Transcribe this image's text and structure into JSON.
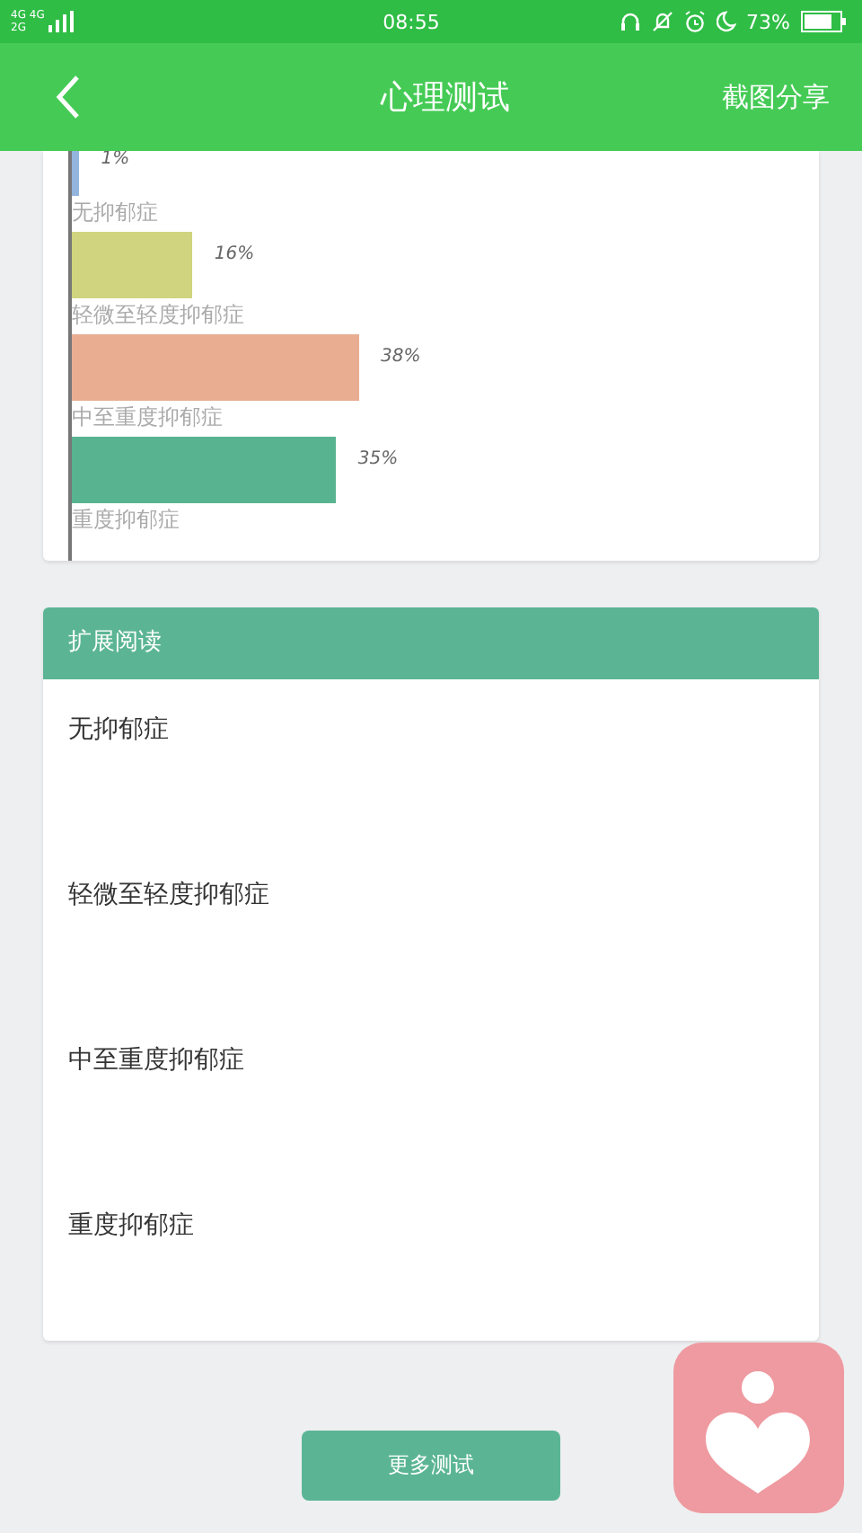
{
  "status_bar": {
    "network_top": "4G 4G",
    "network_bottom": "2G",
    "time": "08:55",
    "battery": "73%"
  },
  "header": {
    "title": "心理测试",
    "action": "截图分享"
  },
  "result_chart": {
    "chart_data": {
      "type": "bar",
      "orientation": "horizontal",
      "categories": [
        "无抑郁症",
        "轻微至轻度抑郁症",
        "中至重度抑郁症",
        "重度抑郁症"
      ],
      "values": [
        1,
        16,
        38,
        35
      ],
      "data_labels": true,
      "value_labels": [
        "1%",
        "16%",
        "38%",
        "35%"
      ],
      "colors": [
        "#93b4dd",
        "#d0d47e",
        "#e9ae92",
        "#58b490"
      ]
    }
  },
  "reading": {
    "title": "扩展阅读",
    "items": [
      "无抑郁症",
      "轻微至轻度抑郁症",
      "中至重度抑郁症",
      "重度抑郁症"
    ]
  },
  "more_button": "更多测试"
}
